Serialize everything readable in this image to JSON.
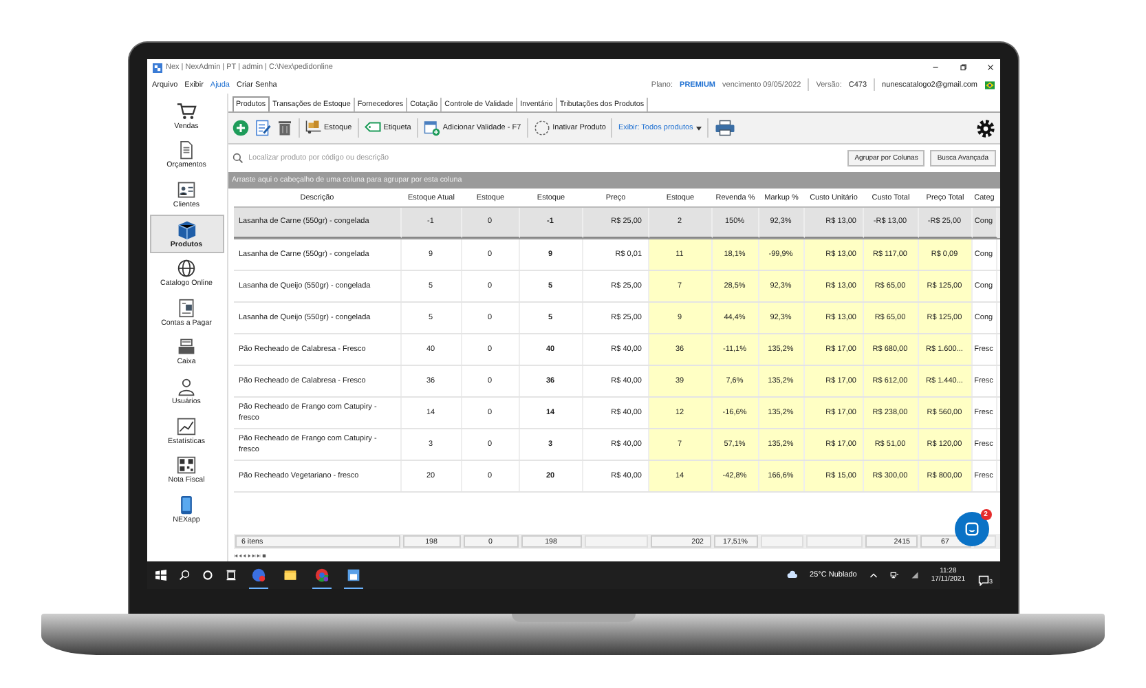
{
  "window": {
    "title": "Nex | NexAdmin | PT | admin | C:\\Nex\\pedidonline"
  },
  "menu": [
    {
      "label": "Arquivo",
      "highlighted": false
    },
    {
      "label": "Exibir",
      "highlighted": false
    },
    {
      "label": "Ajuda",
      "highlighted": true
    },
    {
      "label": "Criar Senha",
      "highlighted": false
    }
  ],
  "account": {
    "plan_label": "Plano:",
    "plan": "PREMIUM",
    "expiry": "vencimento 09/05/2022",
    "version_label": "Versão:",
    "version": "C473",
    "email": "nunescatalogo2@gmail.com"
  },
  "sidebar": [
    {
      "label": "Vendas",
      "selected": false
    },
    {
      "label": "Orçamentos",
      "selected": false
    },
    {
      "label": "Clientes",
      "selected": false
    },
    {
      "label": "Produtos",
      "selected": true
    },
    {
      "label": "Catalogo Online",
      "selected": false
    },
    {
      "label": "Contas a Pagar",
      "selected": false
    },
    {
      "label": "Caixa",
      "selected": false
    },
    {
      "label": "Usuários",
      "selected": false
    },
    {
      "label": "Estatísticas",
      "selected": false
    },
    {
      "label": "Nota Fiscal",
      "selected": false
    },
    {
      "label": "NEXapp",
      "selected": false
    }
  ],
  "tabs": [
    {
      "label": "Produtos",
      "selected": true
    },
    {
      "label": "Transações de Estoque",
      "selected": false
    },
    {
      "label": "Fornecedores",
      "selected": false
    },
    {
      "label": "Cotação",
      "selected": false
    },
    {
      "label": "Controle de Validade",
      "selected": false
    },
    {
      "label": "Inventário",
      "selected": false
    },
    {
      "label": "Tributações dos Produtos",
      "selected": false
    }
  ],
  "toolbar": {
    "buttons": [
      {
        "label": "Estoque"
      },
      {
        "label": "Etiqueta"
      },
      {
        "label": "Adicionar Validade - F7"
      },
      {
        "label": "Inativar Produto"
      }
    ],
    "filter": "Exibir: Todos produtos"
  },
  "search": {
    "placeholder": "Localizar produto por código ou descrição",
    "buttons": [
      "Agrupar por Colunas",
      "Busca Avançada"
    ]
  },
  "group_hint": "Arraste aqui o cabeçalho de uma coluna para agrupar por esta coluna",
  "table": {
    "columns": [
      {
        "label": "Descrição",
        "highlighted": false,
        "bold": false
      },
      {
        "label": "Estoque Atual",
        "highlighted": false,
        "bold": false
      },
      {
        "label": "Estoque",
        "highlighted": false,
        "bold": false
      },
      {
        "label": "Estoque",
        "highlighted": false,
        "bold": true
      },
      {
        "label": "Preço",
        "highlighted": false,
        "bold": false
      },
      {
        "label": "Estoque",
        "highlighted": true,
        "bold": false
      },
      {
        "label": "Revenda %",
        "highlighted": true,
        "bold": false
      },
      {
        "label": "Markup %",
        "highlighted": true,
        "bold": false
      },
      {
        "label": "Custo Unitário",
        "highlighted": true,
        "bold": false
      },
      {
        "label": "Custo Total",
        "highlighted": true,
        "bold": false
      },
      {
        "label": "Preço Total",
        "highlighted": true,
        "bold": false
      },
      {
        "label": "Categ",
        "highlighted": false,
        "bold": false
      }
    ],
    "rows": [
      {
        "selected": true,
        "cells": [
          "Lasanha de Carne (550gr) - congelada",
          "-1",
          "0",
          "-1",
          "R$ 25,00",
          "2",
          "150%",
          "92,3%",
          "R$ 13,00",
          "-R$ 13,00",
          "-R$ 25,00",
          "Cong"
        ]
      },
      {
        "selected": false,
        "cells": [
          "Lasanha de Carne (550gr) - congelada",
          "9",
          "0",
          "9",
          "R$ 0,01",
          "11",
          "18,1%",
          "-99,9%",
          "R$ 13,00",
          "R$ 117,00",
          "R$ 0,09",
          "Cong"
        ]
      },
      {
        "selected": false,
        "cells": [
          "Lasanha de Queijo (550gr) - congelada",
          "5",
          "0",
          "5",
          "R$ 25,00",
          "7",
          "28,5%",
          "92,3%",
          "R$ 13,00",
          "R$ 65,00",
          "R$ 125,00",
          "Cong"
        ]
      },
      {
        "selected": false,
        "cells": [
          "Lasanha de Queijo (550gr) - congelada",
          "5",
          "0",
          "5",
          "R$ 25,00",
          "9",
          "44,4%",
          "92,3%",
          "R$ 13,00",
          "R$ 65,00",
          "R$ 125,00",
          "Cong"
        ]
      },
      {
        "selected": false,
        "cells": [
          "Pão Recheado de Calabresa - Fresco",
          "40",
          "0",
          "40",
          "R$ 40,00",
          "36",
          "-11,1%",
          "135,2%",
          "R$ 17,00",
          "R$ 680,00",
          "R$ 1.600...",
          "Fresc"
        ]
      },
      {
        "selected": false,
        "cells": [
          "Pão Recheado de Calabresa - Fresco",
          "36",
          "0",
          "36",
          "R$ 40,00",
          "39",
          "7,6%",
          "135,2%",
          "R$ 17,00",
          "R$ 612,00",
          "R$ 1.440...",
          "Fresc"
        ]
      },
      {
        "selected": false,
        "cells": [
          "Pão Recheado de Frango com Catupiry - fresco",
          "14",
          "0",
          "14",
          "R$ 40,00",
          "12",
          "-16,6%",
          "135,2%",
          "R$ 17,00",
          "R$ 238,00",
          "R$ 560,00",
          "Fresc"
        ]
      },
      {
        "selected": false,
        "cells": [
          "Pão Recheado de Frango com Catupiry - fresco",
          "3",
          "0",
          "3",
          "R$ 40,00",
          "7",
          "57,1%",
          "135,2%",
          "R$ 17,00",
          "R$ 51,00",
          "R$ 120,00",
          "Fresc"
        ]
      },
      {
        "selected": false,
        "cells": [
          "Pão Recheado Vegetariano - fresco",
          "20",
          "0",
          "20",
          "R$ 40,00",
          "14",
          "-42,8%",
          "166,6%",
          "R$ 15,00",
          "R$ 300,00",
          "R$ 800,00",
          "Fresc"
        ]
      }
    ],
    "footer": [
      {
        "kind": "value",
        "text": "6 itens"
      },
      {
        "kind": "value",
        "text": "198"
      },
      {
        "kind": "value",
        "text": "0"
      },
      {
        "kind": "value",
        "text": "198"
      },
      {
        "kind": "blank"
      },
      {
        "kind": "value",
        "text": "202"
      },
      {
        "kind": "value",
        "text": "17,51%"
      },
      {
        "kind": "blank"
      },
      {
        "kind": "blank"
      },
      {
        "kind": "value",
        "text": "2415"
      },
      {
        "kind": "value",
        "text": "67"
      },
      {
        "kind": "blank"
      }
    ]
  },
  "chat": {
    "badge": "2"
  },
  "taskbar": {
    "apps": [
      {
        "running": true
      },
      {
        "running": false
      },
      {
        "running": true
      },
      {
        "running": true
      }
    ],
    "weather": "25°C Nublado",
    "time": "11:28",
    "date": "17/11/2021",
    "notifications": "3"
  }
}
